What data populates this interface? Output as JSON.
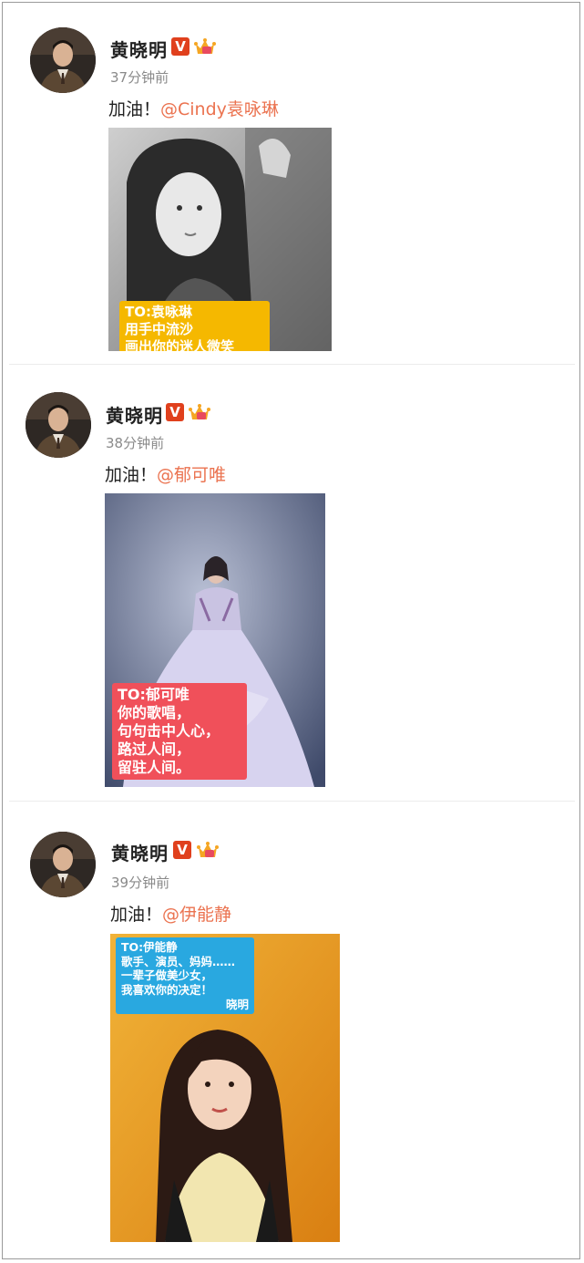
{
  "posts": [
    {
      "author": "黄晓明",
      "verified_badge": "V",
      "time": "37分钟前",
      "text_prefix": "加油！",
      "mention": "@Cindy袁咏琳",
      "photo_caption": [
        "TO:袁咏琳",
        "用手中流沙",
        "画出你的迷人微笑"
      ],
      "caption_color": "#f5b800"
    },
    {
      "author": "黄晓明",
      "verified_badge": "V",
      "time": "38分钟前",
      "text_prefix": "加油！",
      "mention": "@郁可唯",
      "photo_caption": [
        "TO:郁可唯",
        "你的歌唱，",
        "句句击中人心，",
        "路过人间，",
        "留驻人间。"
      ],
      "caption_color": "#f0505a"
    },
    {
      "author": "黄晓明",
      "verified_badge": "V",
      "time": "39分钟前",
      "text_prefix": "加油！",
      "mention": "@伊能静",
      "photo_caption": [
        "TO:伊能静",
        "歌手、演员、妈妈……",
        "一辈子做美少女，",
        "我喜欢你的决定！",
        "晓明"
      ],
      "caption_color": "#29a8e0"
    }
  ],
  "icons": {
    "avatar": "avatar-photo",
    "verified": "verified-v-icon",
    "crown": "member-crown-icon"
  },
  "colors": {
    "mention": "#eb7350",
    "verified": "#e0401d",
    "time": "#8a8a8a"
  }
}
